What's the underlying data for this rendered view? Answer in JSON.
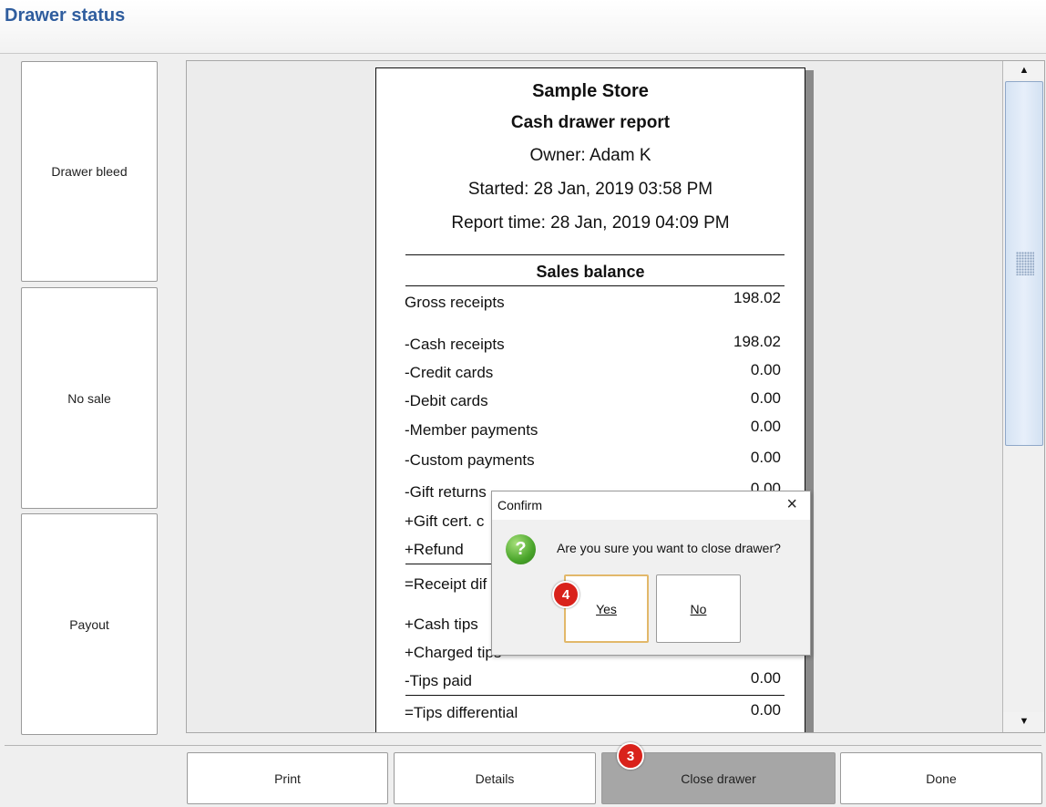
{
  "header": {
    "title": "Drawer status"
  },
  "sidebar": {
    "buttons": [
      "Drawer bleed",
      "No sale",
      "Payout"
    ]
  },
  "report": {
    "store": "Sample Store",
    "title": "Cash drawer report",
    "owner": "Owner: Adam K",
    "started": "Started: 28 Jan, 2019 03:58 PM",
    "report_time": "Report time: 28 Jan, 2019 04:09 PM",
    "section": "Sales balance",
    "rows": [
      {
        "label": "Gross receipts",
        "value": "198.02"
      },
      {
        "label": "-Cash receipts",
        "value": "198.02"
      },
      {
        "label": "-Credit cards",
        "value": "0.00"
      },
      {
        "label": "-Debit cards",
        "value": "0.00"
      },
      {
        "label": "-Member payments",
        "value": "0.00"
      },
      {
        "label": "-Custom payments",
        "value": "0.00"
      },
      {
        "label": "-Gift returns",
        "value": "0.00"
      },
      {
        "label": "+Gift cert. c",
        "value": ""
      },
      {
        "label": "+Refund",
        "value": ""
      },
      {
        "label": "=Receipt dif",
        "value": ""
      },
      {
        "label": "+Cash tips",
        "value": ""
      },
      {
        "label": "+Charged tips",
        "value": ""
      },
      {
        "label": "-Tips paid",
        "value": "0.00"
      },
      {
        "label": "=Tips differential",
        "value": "0.00"
      }
    ]
  },
  "bottom_bar": {
    "buttons": [
      "Print",
      "Details",
      "Close drawer",
      "Done"
    ]
  },
  "step_badges": {
    "close_drawer": "3",
    "yes": "4"
  },
  "dialog": {
    "title": "Confirm",
    "close_icon": "×",
    "icon": "?",
    "message": "Are you sure you want to close drawer?",
    "yes_label": "Yes",
    "no_label": "No"
  },
  "colors": {
    "title": "#2f5d9e",
    "active_button": "#a6a6a6",
    "badge": "#d9221b",
    "focus_border": "#e2b86a"
  }
}
